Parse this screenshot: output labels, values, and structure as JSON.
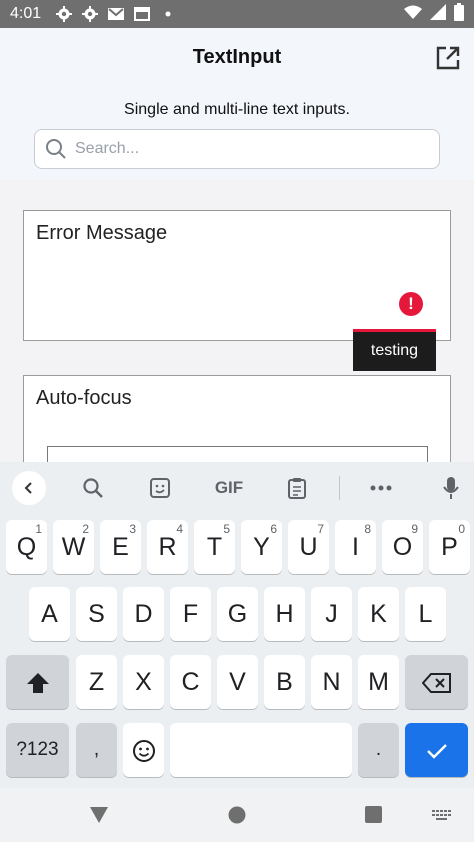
{
  "status_bar": {
    "time": "4:01"
  },
  "app": {
    "title": "TextInput",
    "subtitle": "Single and multi-line text inputs.",
    "search_placeholder": "Search..."
  },
  "fields": {
    "error_label": "Error Message",
    "error_tooltip": "testing",
    "error_icon": "!",
    "autofocus_label": "Auto-focus"
  },
  "keyboard": {
    "suggestion_bar": {
      "gif_label": "GIF"
    },
    "row1": [
      {
        "key": "Q",
        "hint": "1"
      },
      {
        "key": "W",
        "hint": "2"
      },
      {
        "key": "E",
        "hint": "3"
      },
      {
        "key": "R",
        "hint": "4"
      },
      {
        "key": "T",
        "hint": "5"
      },
      {
        "key": "Y",
        "hint": "6"
      },
      {
        "key": "U",
        "hint": "7"
      },
      {
        "key": "I",
        "hint": "8"
      },
      {
        "key": "O",
        "hint": "9"
      },
      {
        "key": "P",
        "hint": "0"
      }
    ],
    "row2": [
      "A",
      "S",
      "D",
      "F",
      "G",
      "H",
      "J",
      "K",
      "L"
    ],
    "row3": [
      "Z",
      "X",
      "C",
      "V",
      "B",
      "N",
      "M"
    ],
    "symbols_label": "?123",
    "comma_label": ",",
    "period_label": "."
  },
  "colors": {
    "accent": "#1a73e8",
    "error": "#e5183b"
  }
}
